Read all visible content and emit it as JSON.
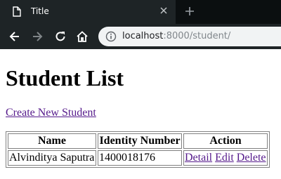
{
  "browser": {
    "tab_title": "Title",
    "url_host": "localhost",
    "url_rest": ":8000/student/"
  },
  "page": {
    "heading": "Student List",
    "create_link": "Create New Student",
    "table": {
      "headers": [
        "Name",
        "Identity Number",
        "Action"
      ],
      "rows": [
        {
          "name": "Alvinditya Saputra",
          "identity_number": "1400018176",
          "actions": [
            "Detail",
            "Edit",
            "Delete"
          ]
        }
      ]
    }
  },
  "colors": {
    "tab_bar": "#0b0f10",
    "toolbar": "#1e2426",
    "omnibox": "#f1f3f4",
    "visited_link": "#551a8b"
  }
}
